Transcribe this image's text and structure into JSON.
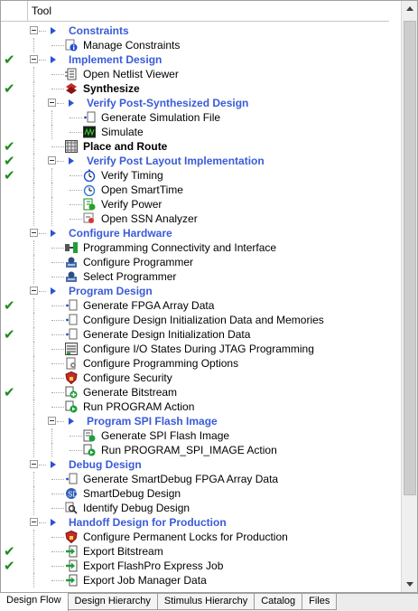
{
  "header": {
    "tool_label": "Tool"
  },
  "colors": {
    "category": "#3a5bd8",
    "check": "#1f8a1f"
  },
  "rows": [
    {
      "label": "Constraints",
      "level": 0,
      "kind": "category",
      "expander": true,
      "check": false
    },
    {
      "label": "Manage Constraints",
      "level": 1,
      "kind": "tool",
      "icon": "info-icon",
      "check": false
    },
    {
      "label": "Implement Design",
      "level": 0,
      "kind": "category",
      "expander": true,
      "check": true
    },
    {
      "label": "Open Netlist Viewer",
      "level": 1,
      "kind": "tool",
      "icon": "netlist-icon",
      "check": false
    },
    {
      "label": "Synthesize",
      "level": 1,
      "kind": "bold",
      "icon": "synthesize-icon",
      "check": true
    },
    {
      "label": "Verify Post-Synthesized Design",
      "level": 1,
      "kind": "category",
      "expander": true,
      "check": false
    },
    {
      "label": "Generate Simulation File",
      "level": 2,
      "kind": "tool",
      "icon": "generate-file-icon",
      "check": false
    },
    {
      "label": "Simulate",
      "level": 2,
      "kind": "tool",
      "icon": "simulate-icon",
      "check": false
    },
    {
      "label": "Place and Route",
      "level": 1,
      "kind": "bold",
      "icon": "place-route-icon",
      "check": true
    },
    {
      "label": "Verify Post Layout Implementation",
      "level": 1,
      "kind": "category",
      "expander": true,
      "check": true
    },
    {
      "label": "Verify Timing",
      "level": 2,
      "kind": "tool",
      "icon": "timing-icon",
      "check": true
    },
    {
      "label": "Open SmartTime",
      "level": 2,
      "kind": "tool",
      "icon": "smarttime-icon",
      "check": false
    },
    {
      "label": "Verify Power",
      "level": 2,
      "kind": "tool",
      "icon": "power-icon",
      "check": false
    },
    {
      "label": "Open SSN Analyzer",
      "level": 2,
      "kind": "tool",
      "icon": "ssn-icon",
      "check": false
    },
    {
      "label": "Configure Hardware",
      "level": 0,
      "kind": "category",
      "expander": true,
      "check": false
    },
    {
      "label": "Programming Connectivity and Interface",
      "level": 1,
      "kind": "tool",
      "icon": "connectivity-icon",
      "check": false
    },
    {
      "label": "Configure Programmer",
      "level": 1,
      "kind": "tool",
      "icon": "programmer-icon",
      "check": false
    },
    {
      "label": "Select Programmer",
      "level": 1,
      "kind": "tool",
      "icon": "programmer-icon",
      "check": false
    },
    {
      "label": "Program Design",
      "level": 0,
      "kind": "category",
      "expander": true,
      "check": false
    },
    {
      "label": "Generate FPGA Array Data",
      "level": 1,
      "kind": "tool",
      "icon": "generate-file-icon",
      "check": true
    },
    {
      "label": "Configure Design Initialization Data and Memories",
      "level": 1,
      "kind": "tool",
      "icon": "generate-file-icon",
      "check": false
    },
    {
      "label": "Generate Design Initialization Data",
      "level": 1,
      "kind": "tool",
      "icon": "generate-file-icon",
      "check": true
    },
    {
      "label": "Configure I/O States During JTAG Programming",
      "level": 1,
      "kind": "tool",
      "icon": "io-states-icon",
      "check": false
    },
    {
      "label": "Configure Programming Options",
      "level": 1,
      "kind": "tool",
      "icon": "options-icon",
      "check": false
    },
    {
      "label": "Configure Security",
      "level": 1,
      "kind": "tool",
      "icon": "security-icon",
      "check": false
    },
    {
      "label": "Generate Bitstream",
      "level": 1,
      "kind": "tool",
      "icon": "bitstream-icon",
      "check": true
    },
    {
      "label": "Run PROGRAM Action",
      "level": 1,
      "kind": "tool",
      "icon": "run-action-icon",
      "check": false
    },
    {
      "label": "Program SPI Flash Image",
      "level": 1,
      "kind": "category",
      "expander": true,
      "check": false
    },
    {
      "label": "Generate SPI Flash Image",
      "level": 2,
      "kind": "tool",
      "icon": "spi-image-icon",
      "check": false
    },
    {
      "label": "Run PROGRAM_SPI_IMAGE Action",
      "level": 2,
      "kind": "tool",
      "icon": "run-action-icon",
      "check": false
    },
    {
      "label": "Debug Design",
      "level": 0,
      "kind": "category",
      "expander": true,
      "check": false
    },
    {
      "label": "Generate SmartDebug FPGA Array Data",
      "level": 1,
      "kind": "tool",
      "icon": "generate-file-icon",
      "check": false
    },
    {
      "label": "SmartDebug Design",
      "level": 1,
      "kind": "tool",
      "icon": "smartdebug-icon",
      "check": false
    },
    {
      "label": "Identify Debug Design",
      "level": 1,
      "kind": "tool",
      "icon": "identify-icon",
      "check": false
    },
    {
      "label": "Handoff Design for Production",
      "level": 0,
      "kind": "category",
      "expander": true,
      "check": false
    },
    {
      "label": "Configure Permanent Locks for Production",
      "level": 1,
      "kind": "tool",
      "icon": "security-icon",
      "check": false
    },
    {
      "label": "Export Bitstream",
      "level": 1,
      "kind": "tool",
      "icon": "export-icon",
      "check": true
    },
    {
      "label": "Export FlashPro Express Job",
      "level": 1,
      "kind": "tool",
      "icon": "export-icon",
      "check": true
    },
    {
      "label": "Export Job Manager Data",
      "level": 1,
      "kind": "tool",
      "icon": "export-icon",
      "check": false
    }
  ],
  "tabs": [
    {
      "label": "Design Flow",
      "active": true
    },
    {
      "label": "Design Hierarchy",
      "active": false
    },
    {
      "label": "Stimulus Hierarchy",
      "active": false
    },
    {
      "label": "Catalog",
      "active": false
    },
    {
      "label": "Files",
      "active": false
    }
  ]
}
